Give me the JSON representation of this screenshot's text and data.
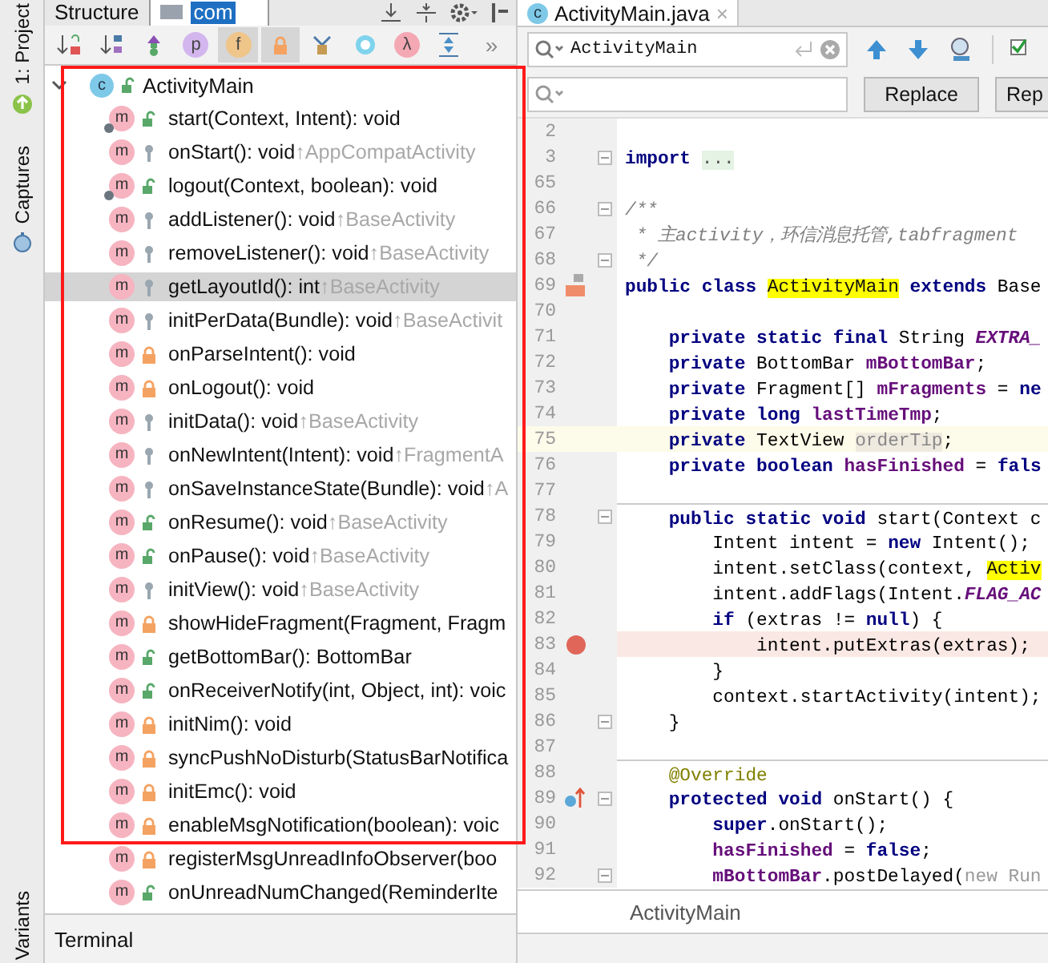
{
  "side_strip": {
    "top_label": "1: Project",
    "middle_label": "Captures",
    "bottom_label": "Variants"
  },
  "structure": {
    "title": "Structure",
    "speed_search": "com",
    "toolbar": [
      {
        "kind": "sort-visibility",
        "selected": false
      },
      {
        "kind": "sort-alpha",
        "selected": false
      },
      {
        "kind": "inherited",
        "selected": false
      },
      {
        "kind": "letter",
        "label": "p",
        "color": "#d3b6ee",
        "selected": false
      },
      {
        "kind": "letter",
        "label": "f",
        "color": "#f0c58a",
        "selected": true
      },
      {
        "kind": "non-public",
        "selected": true
      },
      {
        "kind": "anonymous",
        "selected": false
      },
      {
        "kind": "ring",
        "color": "#7fd3ec",
        "selected": false
      },
      {
        "kind": "letter",
        "label": "λ",
        "color": "#f4a8b4",
        "selected": false
      },
      {
        "kind": "expand",
        "selected": false
      },
      {
        "kind": "more",
        "label": "»",
        "selected": false
      }
    ],
    "root": {
      "icon_letter": "c",
      "name": "ActivityMain",
      "expanded": true,
      "members": [
        {
          "icon_letter": "m",
          "signature": "start(Context, Intent): void",
          "kind": "public",
          "static": true,
          "selected": false
        },
        {
          "icon_letter": "m",
          "signature": "onStart(): void",
          "inherited": "↑AppCompatActivity",
          "kind": "protected",
          "static": false,
          "selected": false
        },
        {
          "icon_letter": "m",
          "signature": "logout(Context, boolean): void",
          "kind": "public",
          "static": true,
          "selected": false
        },
        {
          "icon_letter": "m",
          "signature": "addListener(): void",
          "inherited": "↑BaseActivity",
          "kind": "protected",
          "static": false,
          "selected": false
        },
        {
          "icon_letter": "m",
          "signature": "removeListener(): void",
          "inherited": "↑BaseActivity",
          "kind": "protected",
          "static": false,
          "selected": false
        },
        {
          "icon_letter": "m",
          "signature": "getLayoutId(): int",
          "inherited": "↑BaseActivity",
          "kind": "protected",
          "static": false,
          "selected": true
        },
        {
          "icon_letter": "m",
          "signature": "initPerData(Bundle): void",
          "inherited": "↑BaseActivit",
          "kind": "protected",
          "static": false,
          "selected": false
        },
        {
          "icon_letter": "m",
          "signature": "onParseIntent(): void",
          "kind": "private",
          "static": false,
          "selected": false
        },
        {
          "icon_letter": "m",
          "signature": "onLogout(): void",
          "kind": "private",
          "static": false,
          "selected": false
        },
        {
          "icon_letter": "m",
          "signature": "initData(): void",
          "inherited": "↑BaseActivity",
          "kind": "protected",
          "static": false,
          "selected": false
        },
        {
          "icon_letter": "m",
          "signature": "onNewIntent(Intent): void",
          "inherited": "↑FragmentA",
          "kind": "protected",
          "static": false,
          "selected": false
        },
        {
          "icon_letter": "m",
          "signature": "onSaveInstanceState(Bundle): void",
          "inherited": "↑A",
          "kind": "protected",
          "static": false,
          "selected": false
        },
        {
          "icon_letter": "m",
          "signature": "onResume(): void",
          "inherited": "↑BaseActivity",
          "kind": "public",
          "static": false,
          "selected": false
        },
        {
          "icon_letter": "m",
          "signature": "onPause(): void",
          "inherited": "↑BaseActivity",
          "kind": "public",
          "static": false,
          "selected": false
        },
        {
          "icon_letter": "m",
          "signature": "initView(): void",
          "inherited": "↑BaseActivity",
          "kind": "protected",
          "static": false,
          "selected": false
        },
        {
          "icon_letter": "m",
          "signature": "showHideFragment(Fragment, Fragm",
          "kind": "private",
          "static": false,
          "selected": false
        },
        {
          "icon_letter": "m",
          "signature": "getBottomBar(): BottomBar",
          "kind": "public",
          "static": false,
          "selected": false
        },
        {
          "icon_letter": "m",
          "signature": "onReceiverNotify(int, Object, int): voic",
          "kind": "public",
          "static": false,
          "selected": false
        },
        {
          "icon_letter": "m",
          "signature": "initNim(): void",
          "kind": "private",
          "static": false,
          "selected": false
        },
        {
          "icon_letter": "m",
          "signature": "syncPushNoDisturb(StatusBarNotifica",
          "kind": "private",
          "static": false,
          "selected": false
        },
        {
          "icon_letter": "m",
          "signature": "initEmc(): void",
          "kind": "private",
          "static": false,
          "selected": false
        },
        {
          "icon_letter": "m",
          "signature": "enableMsgNotification(boolean): voic",
          "kind": "private",
          "static": false,
          "selected": false
        },
        {
          "icon_letter": "m",
          "signature": "registerMsgUnreadInfoObserver(boo",
          "kind": "private",
          "static": false,
          "selected": false
        },
        {
          "icon_letter": "m",
          "signature": "onUnreadNumChanged(ReminderIte",
          "kind": "public",
          "static": false,
          "selected": false
        }
      ]
    }
  },
  "bottom_tab": "Terminal",
  "editor": {
    "tab": {
      "icon_letter": "c",
      "title": "ActivityMain.java",
      "close": "×"
    },
    "find": {
      "value": "ActivityMain",
      "buttons": [
        "Replace",
        "Rep"
      ]
    },
    "lines": [
      {
        "no": "2"
      },
      {
        "no": "3",
        "fold": true,
        "tokens": [
          {
            "t": "import ",
            "kind": "kw"
          },
          {
            "t": "...",
            "kind": "folded"
          }
        ]
      },
      {
        "no": "65"
      },
      {
        "no": "66",
        "fold": true,
        "tokens": [
          {
            "t": "/**",
            "kind": "comment"
          }
        ]
      },
      {
        "no": "67",
        "tokens": [
          {
            "t": " * 主activity，环信消息托管,tabfragment",
            "kind": "comment"
          }
        ]
      },
      {
        "no": "68",
        "fold": true,
        "tokens": [
          {
            "t": " */",
            "kind": "comment"
          }
        ]
      },
      {
        "no": "69",
        "marker": {
          "kind": "class"
        },
        "tokens": [
          {
            "t": "public class ",
            "kind": "kw"
          },
          {
            "t": "ActivityMain",
            "kind": "match"
          },
          {
            "t": " extends",
            "kind": "kw"
          },
          {
            "t": " Base",
            "kind": "plain"
          }
        ]
      },
      {
        "no": "70"
      },
      {
        "no": "71",
        "tokens": [
          {
            "t": "    private static final ",
            "kind": "kw"
          },
          {
            "t": "String ",
            "kind": "plain"
          },
          {
            "t": "EXTRA_",
            "kind": "const"
          }
        ]
      },
      {
        "no": "72",
        "tokens": [
          {
            "t": "    private ",
            "kind": "kw"
          },
          {
            "t": "BottomBar ",
            "kind": "plain"
          },
          {
            "t": "mBottomBar",
            "kind": "field"
          },
          {
            "t": ";",
            "kind": "plain"
          }
        ]
      },
      {
        "no": "73",
        "tokens": [
          {
            "t": "    private ",
            "kind": "kw"
          },
          {
            "t": "Fragment[] ",
            "kind": "plain"
          },
          {
            "t": "mFragments",
            "kind": "field"
          },
          {
            "t": " = ",
            "kind": "plain"
          },
          {
            "t": "ne",
            "kind": "kw"
          }
        ]
      },
      {
        "no": "74",
        "tokens": [
          {
            "t": "    private long ",
            "kind": "kw"
          },
          {
            "t": "lastTimeTmp",
            "kind": "field"
          },
          {
            "t": ";",
            "kind": "plain"
          }
        ]
      },
      {
        "no": "75",
        "current": true,
        "tokens": [
          {
            "t": "    private ",
            "kind": "kw"
          },
          {
            "t": "TextView ",
            "kind": "plain"
          },
          {
            "t": "orderTip",
            "kind": "unused"
          },
          {
            "t": ";",
            "kind": "plain"
          }
        ]
      },
      {
        "no": "76",
        "tokens": [
          {
            "t": "    private boolean ",
            "kind": "kw"
          },
          {
            "t": "hasFinished",
            "kind": "field"
          },
          {
            "t": " = ",
            "kind": "plain"
          },
          {
            "t": "fals",
            "kind": "kw"
          }
        ]
      },
      {
        "no": "77"
      },
      {
        "no": "78",
        "fold": true,
        "separator": true,
        "tokens": [
          {
            "t": "    public static void ",
            "kind": "kw"
          },
          {
            "t": "start(Context c",
            "kind": "plain"
          }
        ]
      },
      {
        "no": "79",
        "tokens": [
          {
            "t": "        Intent intent = ",
            "kind": "plain"
          },
          {
            "t": "new",
            "kind": "kw"
          },
          {
            "t": " Intent();",
            "kind": "plain"
          }
        ]
      },
      {
        "no": "80",
        "tokens": [
          {
            "t": "        intent.setClass(context, ",
            "kind": "plain"
          },
          {
            "t": "Activ",
            "kind": "match"
          }
        ]
      },
      {
        "no": "81",
        "tokens": [
          {
            "t": "        intent.addFlags(Intent.",
            "kind": "plain"
          },
          {
            "t": "FLAG_AC",
            "kind": "const"
          }
        ]
      },
      {
        "no": "82",
        "tokens": [
          {
            "t": "        if",
            "kind": "kw"
          },
          {
            "t": " (extras != ",
            "kind": "plain"
          },
          {
            "t": "null",
            "kind": "kw"
          },
          {
            "t": ") {",
            "kind": "plain"
          }
        ]
      },
      {
        "no": "83",
        "marker": {
          "kind": "breakpoint"
        },
        "tokens": [
          {
            "t": "            intent.putExtras(extras);",
            "kind": "plain"
          }
        ]
      },
      {
        "no": "84",
        "tokens": [
          {
            "t": "        }",
            "kind": "plain"
          }
        ]
      },
      {
        "no": "85",
        "tokens": [
          {
            "t": "        context.startActivity(intent);",
            "kind": "plain"
          }
        ]
      },
      {
        "no": "86",
        "fold": true,
        "tokens": [
          {
            "t": "    }",
            "kind": "plain"
          }
        ]
      },
      {
        "no": "87"
      },
      {
        "no": "88",
        "separator": true,
        "tokens": [
          {
            "t": "    @Override",
            "kind": "annot"
          }
        ]
      },
      {
        "no": "89",
        "marker": {
          "kind": "override"
        },
        "fold": true,
        "tokens": [
          {
            "t": "    protected void ",
            "kind": "kw"
          },
          {
            "t": "onStart() {",
            "kind": "plain"
          }
        ]
      },
      {
        "no": "90",
        "tokens": [
          {
            "t": "        super",
            "kind": "kw"
          },
          {
            "t": ".onStart();",
            "kind": "plain"
          }
        ]
      },
      {
        "no": "91",
        "tokens": [
          {
            "t": "        hasFinished",
            "kind": "field"
          },
          {
            "t": " = ",
            "kind": "plain"
          },
          {
            "t": "false",
            "kind": "kw"
          },
          {
            "t": ";",
            "kind": "plain"
          }
        ]
      },
      {
        "no": "92",
        "fold": true,
        "tokens": [
          {
            "t": "        mBottomBar",
            "kind": "field"
          },
          {
            "t": ".postDelayed(",
            "kind": "plain"
          },
          {
            "t": "new Run",
            "kind": "dim"
          }
        ]
      }
    ],
    "breadcrumb": "ActivityMain"
  }
}
